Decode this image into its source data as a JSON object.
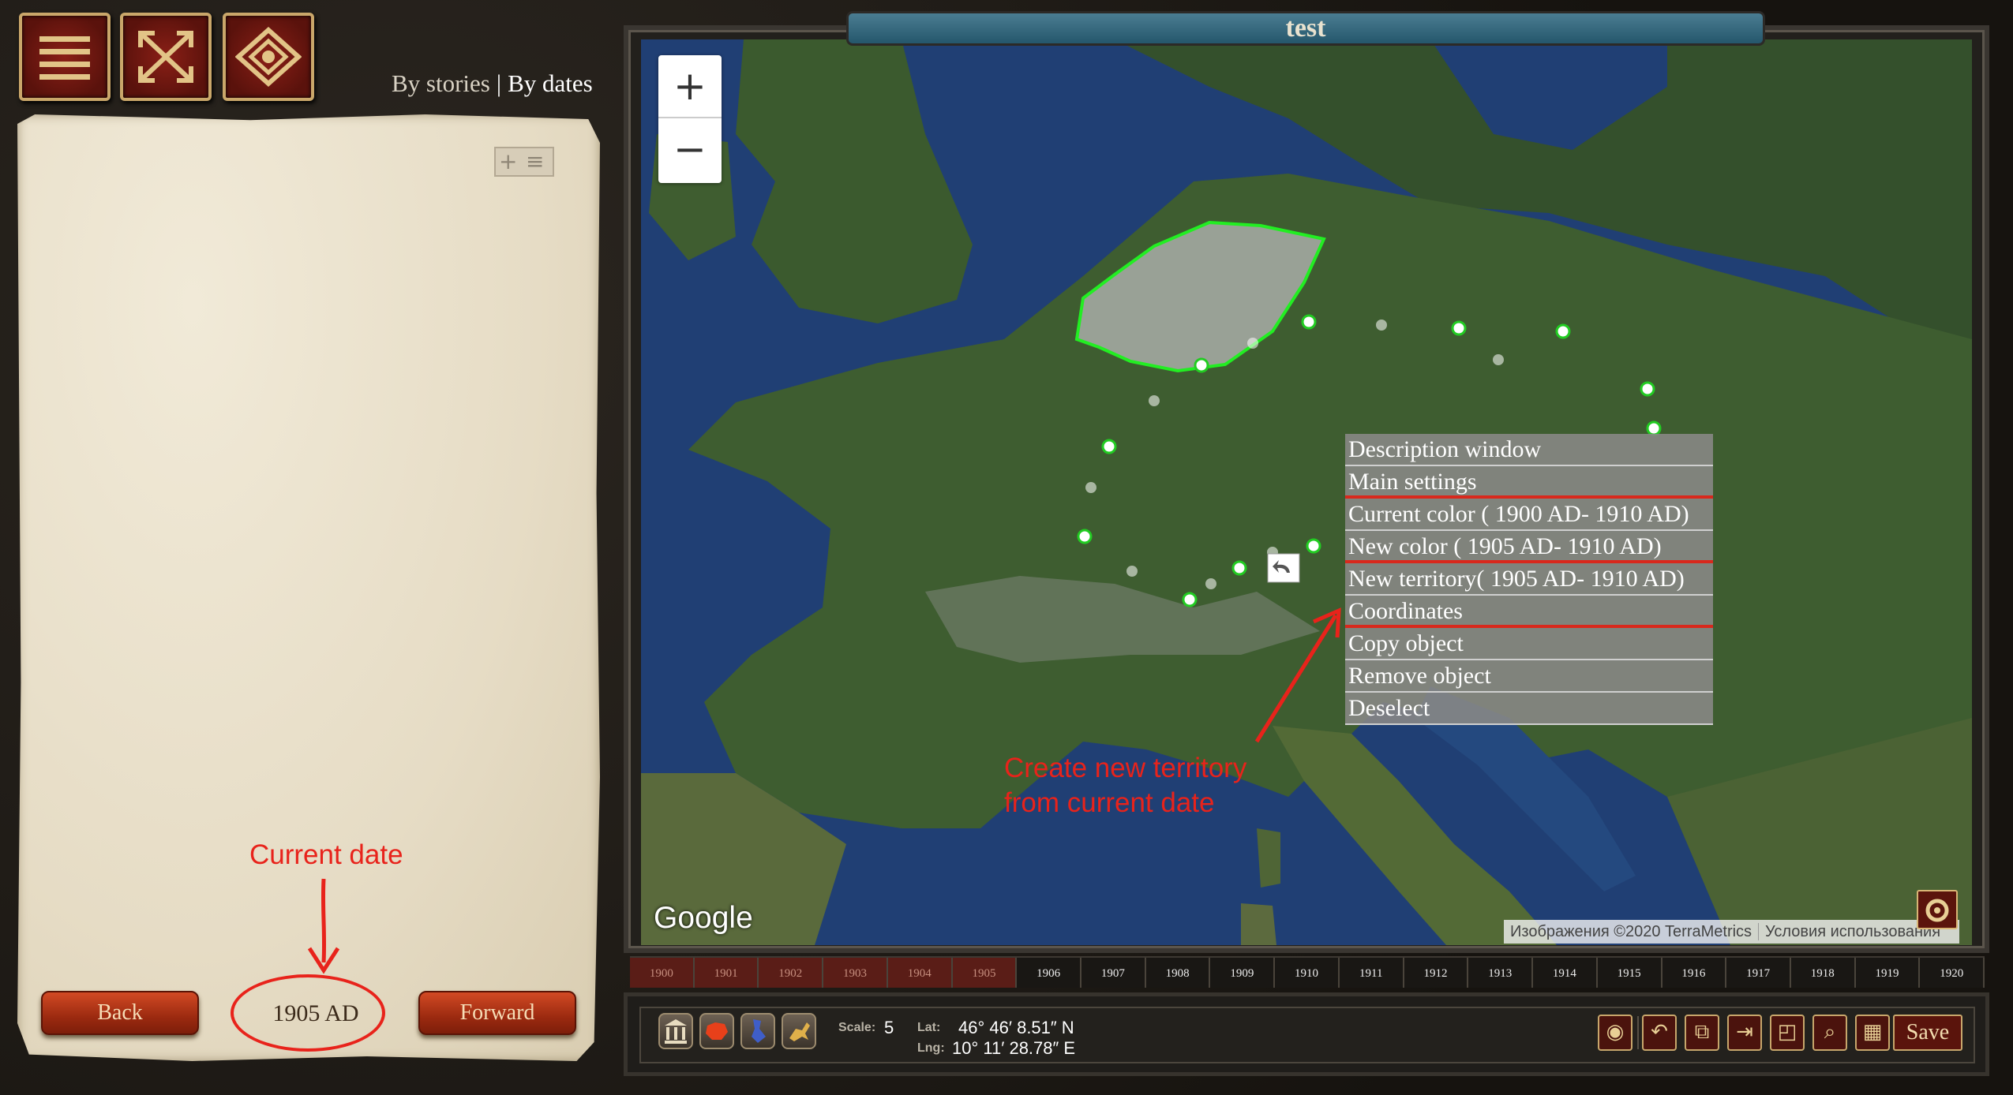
{
  "toolbar": {
    "menu_icon": "menu-icon",
    "fullscreen_icon": "fullscreen-icon",
    "view_icon": "eye-icon"
  },
  "nav": {
    "by_stories": "By stories",
    "separator": "|",
    "by_dates": "By dates"
  },
  "sidebar": {
    "back_label": "Back",
    "forward_label": "Forward",
    "current_date": "1905 AD",
    "expand_icon": "add-list-icon"
  },
  "annotations": {
    "current_date": "Current date",
    "new_territory_line1": "Create new territory",
    "new_territory_line2": "from current date"
  },
  "map": {
    "title": "test",
    "zoom_in": "+",
    "zoom_out": "−",
    "google_logo": "Google",
    "attribution_imagery": "Изображения ©2020 TerraMetrics",
    "attribution_terms": "Условия использования"
  },
  "context_menu": {
    "items": [
      {
        "label": "Description window"
      },
      {
        "label": "Main settings"
      },
      {
        "label": "Current color ( 1900 AD- 1910 AD)"
      },
      {
        "label": "New color ( 1905 AD- 1910 AD)"
      },
      {
        "label": "New territory( 1905 AD- 1910 AD)"
      },
      {
        "label": "Coordinates"
      },
      {
        "label": "Copy object"
      },
      {
        "label": "Remove object"
      },
      {
        "label": "Deselect"
      }
    ]
  },
  "timeline": {
    "years": [
      "1900",
      "1901",
      "1902",
      "1903",
      "1904",
      "1905",
      "1906",
      "1907",
      "1908",
      "1909",
      "1910",
      "1911",
      "1912",
      "1913",
      "1914",
      "1915",
      "1916",
      "1917",
      "1918",
      "1919",
      "1920"
    ],
    "current": "1905"
  },
  "status": {
    "scale_label": "Scale:",
    "scale_value": "5",
    "lat_label": "Lat:",
    "lat_value": "46° 46′ 8.51″ N",
    "lng_label": "Lng:",
    "lng_value": "10° 11′ 28.78″ E"
  },
  "bottom_tools": {
    "save_label": "Save"
  },
  "colors": {
    "accent_red": "#e8231b",
    "polygon_stroke": "#22ee22",
    "menu_separator": "#d9281c",
    "button_red": "#9c2a10"
  }
}
